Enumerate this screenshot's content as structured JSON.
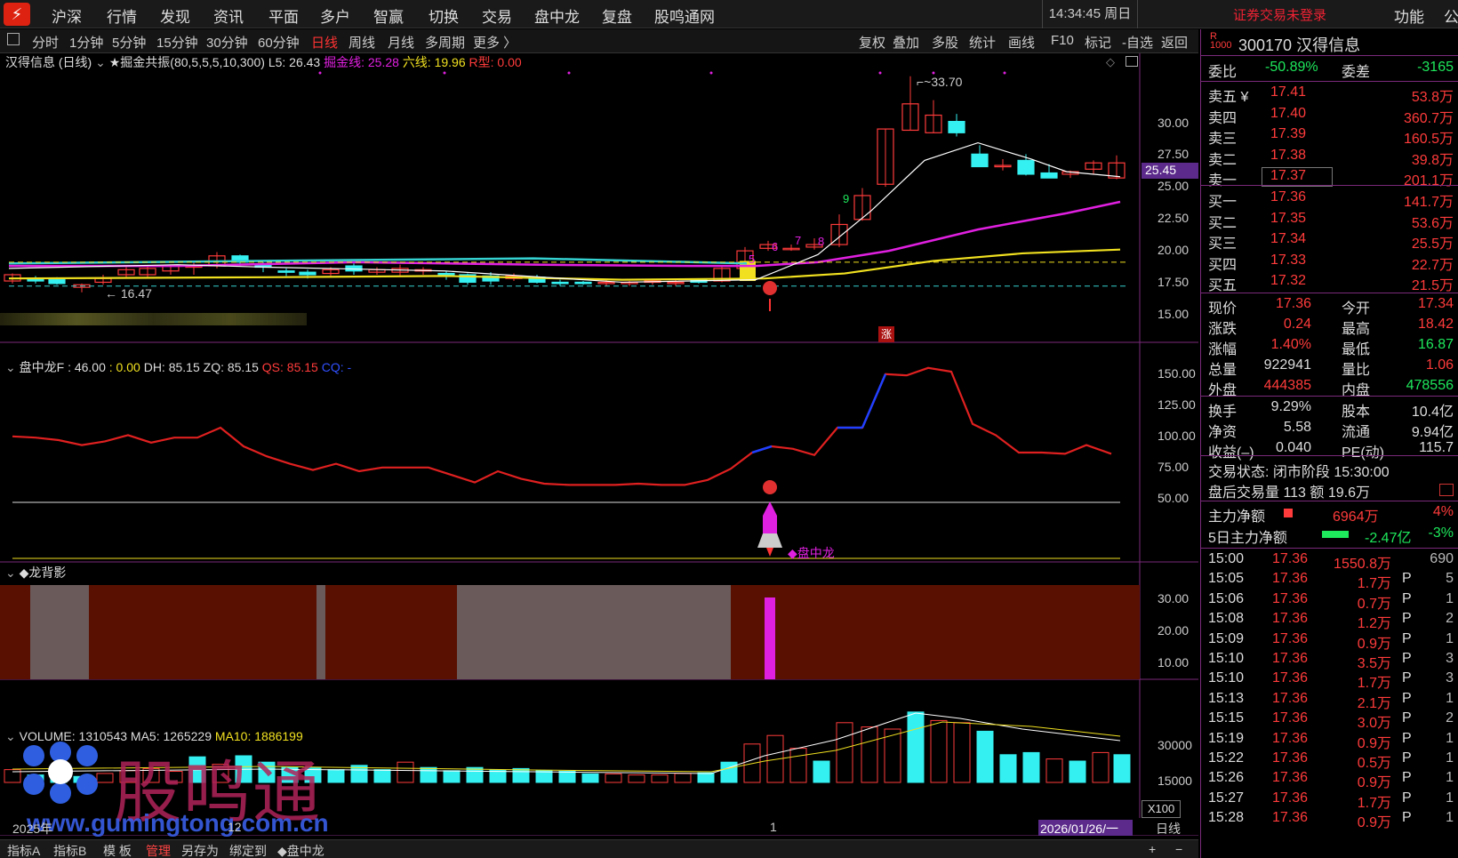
{
  "menu": {
    "items": [
      "沪深",
      "行情",
      "发现",
      "资讯",
      "平面",
      "多户",
      "智赢",
      "切换",
      "交易",
      "盘中龙",
      "复盘",
      "股鸣通网"
    ],
    "clock": "14:34:45 周日",
    "login_status": "证券交易未登录",
    "func": "功能",
    "func_b": "公"
  },
  "toolbar": {
    "periods": [
      "分时",
      "1分钟",
      "5分钟",
      "15分钟",
      "30分钟",
      "60分钟",
      "日线",
      "周线",
      "月线",
      "多周期",
      "更多 〉"
    ],
    "active": "日线",
    "tools": [
      "复权",
      "叠加",
      "多股",
      "统计",
      "画线",
      "F10",
      "标记",
      "-自选",
      "返回"
    ]
  },
  "main_chart": {
    "title": "汉得信息 (日线)",
    "indicator": "★掘金共振(80,5,5,5,10,300)",
    "l5": "L5: 26.43",
    "jj": "掘金线: 25.28",
    "lx": "六线: 19.96",
    "rx": "R型: 0.00",
    "high_label": "33.70",
    "low_label": "← 16.47",
    "current_price": "25.45",
    "y_ticks": [
      "30.00",
      "27.50",
      "25.00",
      "22.50",
      "20.00",
      "17.50",
      "15.00"
    ],
    "markers": [
      "5",
      "6",
      "7",
      "8",
      "9"
    ],
    "zhang": "涨"
  },
  "indicator_panel": {
    "title": "盘中龙F : 46.00",
    "v0": ": 0.00",
    "dh": "DH: 85.15",
    "zq": "ZQ: 85.15",
    "qs": "QS: 85.15",
    "cq": "CQ: -",
    "y_ticks": [
      "150.00",
      "125.00",
      "100.00",
      "75.00",
      "50.00"
    ],
    "signal": "◆盘中龙"
  },
  "shadow_panel": {
    "title": "◆龙背影",
    "y_ticks": [
      "30.00",
      "20.00",
      "10.00"
    ]
  },
  "volume_panel": {
    "vol": "VOLUME: 1310543",
    "ma5": "MA5: 1265229",
    "ma10": "MA10: 1886199",
    "y_ticks": [
      "30000",
      "15000"
    ],
    "unit": "X100",
    "watermark": "股鸣通",
    "watermark_url": "www.gumingtong.com.cn"
  },
  "time_axis": {
    "year": "2025年",
    "m12": "12",
    "m1": "1",
    "cursor_date": "2026/01/26/一",
    "period": "日线"
  },
  "bottom": {
    "tabs": [
      "指标A",
      "指标B",
      "模 板",
      "管理",
      "另存为",
      "绑定到",
      "◆盘中龙"
    ],
    "active": "管理",
    "plus": "+",
    "minus": "−"
  },
  "quote": {
    "code": "300170",
    "name": "汉得信息",
    "r_badge": "R",
    "weibi_label": "委比",
    "weibi": "-50.89%",
    "weicha_label": "委差",
    "weicha": "-3165",
    "asks": [
      {
        "label": "卖五 ¥",
        "price": "17.41",
        "vol": "53.8万"
      },
      {
        "label": "卖四",
        "price": "17.40",
        "vol": "360.7万"
      },
      {
        "label": "卖三",
        "price": "17.39",
        "vol": "160.5万"
      },
      {
        "label": "卖二",
        "price": "17.38",
        "vol": "39.8万"
      },
      {
        "label": "卖一",
        "price": "17.37",
        "vol": "201.1万"
      }
    ],
    "bids": [
      {
        "label": "买一",
        "price": "17.36",
        "vol": "141.7万"
      },
      {
        "label": "买二",
        "price": "17.35",
        "vol": "53.6万"
      },
      {
        "label": "买三",
        "price": "17.34",
        "vol": "25.5万"
      },
      {
        "label": "买四",
        "price": "17.33",
        "vol": "22.7万"
      },
      {
        "label": "买五",
        "price": "17.32",
        "vol": "21.5万"
      }
    ],
    "stats": [
      {
        "l1": "现价",
        "v1": "17.36",
        "c1": "red",
        "l2": "今开",
        "v2": "17.34",
        "c2": "red"
      },
      {
        "l1": "涨跌",
        "v1": "0.24",
        "c1": "red",
        "l2": "最高",
        "v2": "18.42",
        "c2": "red"
      },
      {
        "l1": "涨幅",
        "v1": "1.40%",
        "c1": "red",
        "l2": "最低",
        "v2": "16.87",
        "c2": "green"
      },
      {
        "l1": "总量",
        "v1": "922941",
        "c1": "white",
        "l2": "量比",
        "v2": "1.06",
        "c2": "red"
      },
      {
        "l1": "外盘",
        "v1": "444385",
        "c1": "red",
        "l2": "内盘",
        "v2": "478556",
        "c2": "green"
      }
    ],
    "stats2": [
      {
        "l1": "换手",
        "v1": "9.29%",
        "l2": "股本",
        "v2": "10.4亿"
      },
      {
        "l1": "净资",
        "v1": "5.58",
        "l2": "流通",
        "v2": "9.94亿"
      },
      {
        "l1": "收益(–)",
        "v1": "0.040",
        "l2": "PE(动)",
        "v2": "115.7"
      }
    ],
    "trade_status": "交易状态: 闭市阶段 15:30:00",
    "after_hours": "盘后交易量 113 额 19.6万",
    "main_net_label": "主力净额",
    "main_net": "6964万",
    "main_net_pct": "4%",
    "main5_label": "5日主力净额",
    "main5": "-2.47亿",
    "main5_pct": "-3%",
    "ticks": [
      {
        "t": "15:00",
        "p": "17.36",
        "v": "1550.8万",
        "f": "",
        "n": "690"
      },
      {
        "t": "15:05",
        "p": "17.36",
        "v": "1.7万",
        "f": "P",
        "n": "5"
      },
      {
        "t": "15:06",
        "p": "17.36",
        "v": "0.7万",
        "f": "P",
        "n": "1"
      },
      {
        "t": "15:08",
        "p": "17.36",
        "v": "1.2万",
        "f": "P",
        "n": "2"
      },
      {
        "t": "15:09",
        "p": "17.36",
        "v": "0.9万",
        "f": "P",
        "n": "1"
      },
      {
        "t": "15:10",
        "p": "17.36",
        "v": "3.5万",
        "f": "P",
        "n": "3"
      },
      {
        "t": "15:10",
        "p": "17.36",
        "v": "1.7万",
        "f": "P",
        "n": "3"
      },
      {
        "t": "15:13",
        "p": "17.36",
        "v": "2.1万",
        "f": "P",
        "n": "1"
      },
      {
        "t": "15:15",
        "p": "17.36",
        "v": "3.0万",
        "f": "P",
        "n": "2"
      },
      {
        "t": "15:19",
        "p": "17.36",
        "v": "0.9万",
        "f": "P",
        "n": "1"
      },
      {
        "t": "15:22",
        "p": "17.36",
        "v": "0.5万",
        "f": "P",
        "n": "1"
      },
      {
        "t": "15:26",
        "p": "17.36",
        "v": "0.9万",
        "f": "P",
        "n": "1"
      },
      {
        "t": "15:27",
        "p": "17.36",
        "v": "1.7万",
        "f": "P",
        "n": "1"
      },
      {
        "t": "15:28",
        "p": "17.36",
        "v": "0.9万",
        "f": "P",
        "n": "1"
      }
    ]
  },
  "colors": {
    "up": "#ff3b3b",
    "down": "#35f0f0",
    "ma_white": "#ffffff",
    "ma_magenta": "#e020e0",
    "ma_yellow": "#f0e020",
    "accent": "#7a2a7a"
  }
}
